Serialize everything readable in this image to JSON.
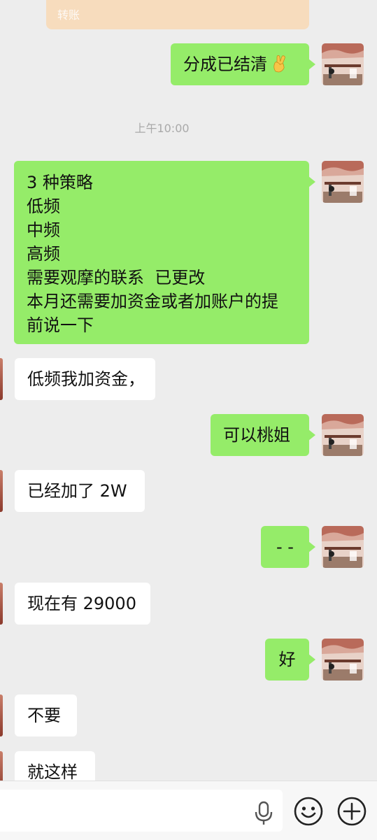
{
  "transfer_card": {
    "label": "转账"
  },
  "timestamp": "上午10:00",
  "messages": [
    {
      "text": "分成已结清"
    },
    {
      "lines": [
        "3 种策略",
        "低频",
        "中频",
        "高频",
        "需要观摩的联系  已更改",
        "本月还需要加资金或者加账户的提",
        "前说一下"
      ]
    },
    {
      "text": "低频我加资金，"
    },
    {
      "text": "可以桃姐"
    },
    {
      "text": "已经加了 2W"
    },
    {
      "text": "- -"
    },
    {
      "text": "现在有 29000"
    },
    {
      "text": "好"
    },
    {
      "text": "不要"
    },
    {
      "text": "就这样"
    }
  ],
  "input": {
    "value": ""
  },
  "icons": [
    "victory-hand-emoji",
    "microphone-icon",
    "emoji-icon",
    "plus-icon"
  ],
  "colors": {
    "outgoing_bubble": "#95ec69",
    "incoming_bubble": "#ffffff",
    "background": "#ededed"
  }
}
